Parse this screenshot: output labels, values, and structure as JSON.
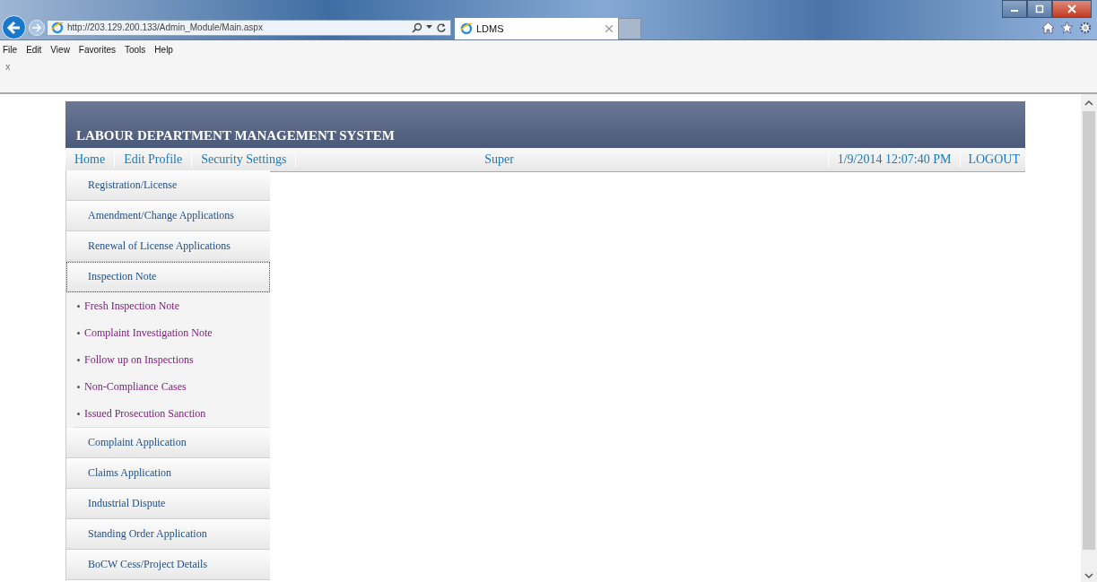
{
  "browser": {
    "url": "http://203.129.200.133/Admin_Module/Main.aspx",
    "tab": {
      "title": "LDMS"
    },
    "menu": [
      "File",
      "Edit",
      "View",
      "Favorites",
      "Tools",
      "Help"
    ],
    "command_bar_close": "x"
  },
  "page": {
    "title": "LABOUR DEPARTMENT MANAGEMENT SYSTEM",
    "nav": [
      "Home",
      "Edit Profile",
      "Security Settings"
    ],
    "user": "Super",
    "datetime": "1/9/2014 12:07:40 PM",
    "logout": "LOGOUT",
    "sidebar": [
      {
        "label": "Registration/License",
        "focused": false
      },
      {
        "label": "Amendment/Change Applications",
        "focused": false
      },
      {
        "label": "Renewal of License Applications",
        "focused": false
      },
      {
        "label": "Inspection Note",
        "focused": true,
        "children": [
          {
            "label": "Fresh Inspection Note"
          },
          {
            "label": "Complaint Investigation Note"
          },
          {
            "label": "Follow up on Inspections"
          },
          {
            "label": "Non-Compliance Cases"
          },
          {
            "label": "Issued Prosecution Sanction"
          }
        ]
      },
      {
        "label": "Complaint Application",
        "focused": false
      },
      {
        "label": "Claims Application",
        "focused": false
      },
      {
        "label": "Industrial Dispute",
        "focused": false
      },
      {
        "label": "Standing Order Application",
        "focused": false
      },
      {
        "label": "BoCW Cess/Project Details",
        "focused": false
      }
    ]
  }
}
